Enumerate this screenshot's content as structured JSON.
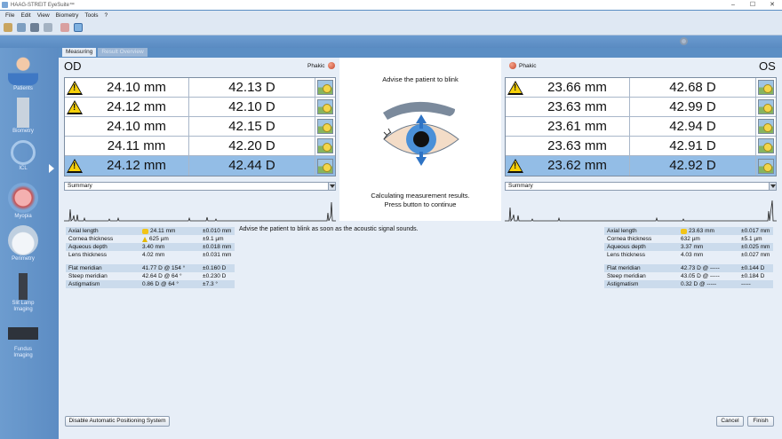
{
  "window": {
    "title": "HAAG-STREIT EyeSuite™",
    "controls": [
      "–",
      "☐",
      "✕"
    ]
  },
  "menu": [
    "File",
    "Edit",
    "View",
    "Biometry",
    "Tools",
    "?"
  ],
  "nav": [
    {
      "label": "Patients"
    },
    {
      "label": "Biometry"
    },
    {
      "label": "ICL"
    },
    {
      "label": "Myopia"
    },
    {
      "label": "Perimetry"
    },
    {
      "label": "Slit Lamp Imaging"
    },
    {
      "label": "Fundus Imaging"
    }
  ],
  "tabs": [
    {
      "label": "Measuring",
      "active": true
    },
    {
      "label": "Result Overview",
      "active": false
    }
  ],
  "od": {
    "label": "OD",
    "lens_status": "Phakic",
    "rows": [
      {
        "mm": "24.10 mm",
        "d": "42.13 D",
        "warn": true,
        "selected": false
      },
      {
        "mm": "24.12 mm",
        "d": "42.10 D",
        "warn": true,
        "selected": false
      },
      {
        "mm": "24.10 mm",
        "d": "42.15 D",
        "warn": false,
        "selected": false
      },
      {
        "mm": "24.11 mm",
        "d": "42.20 D",
        "warn": false,
        "selected": false
      },
      {
        "mm": "24.12 mm",
        "d": "42.44 D",
        "warn": true,
        "selected": true
      }
    ],
    "select_value": "Summary",
    "results": [
      {
        "name": "Axial length",
        "value": "24.11 mm",
        "tol": "±0.010 mm",
        "icon": "sun",
        "shade": true
      },
      {
        "name": "Cornea thickness",
        "value": "625 µm",
        "tol": "±9.1 µm",
        "icon": "warn",
        "shade": false
      },
      {
        "name": "Aqueous depth",
        "value": "3.40 mm",
        "tol": "±0.018 mm",
        "icon": "",
        "shade": true
      },
      {
        "name": "Lens thickness",
        "value": "4.02 mm",
        "tol": "±0.031 mm",
        "icon": "",
        "shade": false
      }
    ],
    "k_results": [
      {
        "name": "Flat meridian",
        "value": "41.77 D @ 154 °",
        "tol": "±0.160 D",
        "shade": true
      },
      {
        "name": "Steep meridian",
        "value": "42.64 D @ 64 °",
        "tol": "±0.230 D",
        "shade": false
      },
      {
        "name": "Astigmatism",
        "value": "0.86 D @ 64 °",
        "tol": "±7.3 °",
        "shade": true
      }
    ]
  },
  "os": {
    "label": "OS",
    "lens_status": "Phakic",
    "rows": [
      {
        "mm": "23.66 mm",
        "d": "42.68 D",
        "warn": true,
        "selected": false
      },
      {
        "mm": "23.63 mm",
        "d": "42.99 D",
        "warn": false,
        "selected": false
      },
      {
        "mm": "23.61 mm",
        "d": "42.94 D",
        "warn": false,
        "selected": false
      },
      {
        "mm": "23.63 mm",
        "d": "42.91 D",
        "warn": false,
        "selected": false
      },
      {
        "mm": "23.62 mm",
        "d": "42.92 D",
        "warn": true,
        "selected": true
      }
    ],
    "select_value": "Summary",
    "results": [
      {
        "name": "Axial length",
        "value": "23.63 mm",
        "tol": "±0.017 mm",
        "icon": "sun",
        "shade": true
      },
      {
        "name": "Cornea thickness",
        "value": "632 µm",
        "tol": "±5.1 µm",
        "icon": "",
        "shade": false
      },
      {
        "name": "Aqueous depth",
        "value": "3.37 mm",
        "tol": "±0.025 mm",
        "icon": "",
        "shade": true
      },
      {
        "name": "Lens thickness",
        "value": "4.03 mm",
        "tol": "±0.027 mm",
        "icon": "",
        "shade": false
      }
    ],
    "k_results": [
      {
        "name": "Flat meridian",
        "value": "42.73 D @ -----",
        "tol": "±0.144 D",
        "shade": true
      },
      {
        "name": "Steep meridian",
        "value": "43.05 D @ -----",
        "tol": "±0.184 D",
        "shade": false
      },
      {
        "name": "Astigmatism",
        "value": "0.32 D @ -----",
        "tol": "-----",
        "shade": true
      }
    ]
  },
  "center": {
    "title": "Advise the patient to blink",
    "message_line1": "Calculating measurement results.",
    "message_line2": "Press button to continue"
  },
  "advise_text": "Advise the patient to blink as soon as the acoustic signal sounds.",
  "buttons": {
    "disable_aps": "Disable Automatic Positioning System",
    "cancel": "Cancel",
    "finish": "Finish"
  },
  "colors": {
    "selected_row": "#93bde6",
    "panel_bg": "#e7eef7",
    "accent_blue": "#5b8ec4"
  }
}
